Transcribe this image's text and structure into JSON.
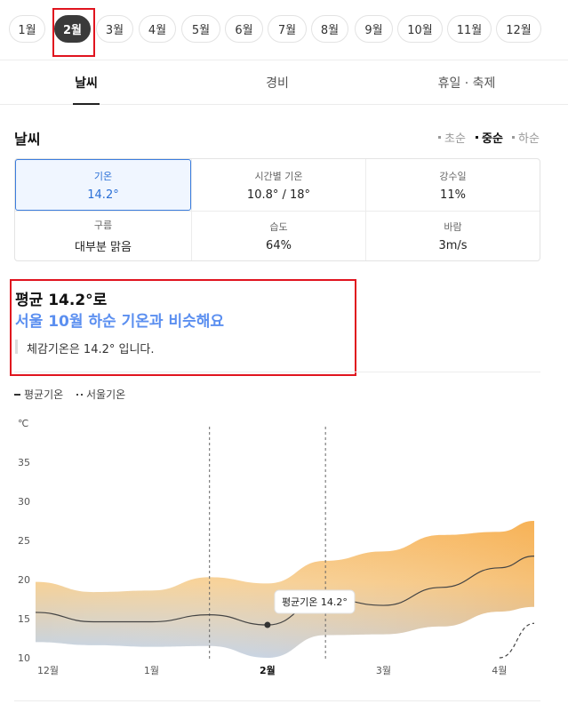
{
  "months": [
    "1월",
    "2월",
    "3월",
    "4월",
    "5월",
    "6월",
    "7월",
    "8월",
    "9월",
    "10월",
    "11월",
    "12월"
  ],
  "active_month": "2월",
  "tabs": [
    "날씨",
    "경비",
    "휴일 · 축제"
  ],
  "section_title": "날씨",
  "seasons": [
    "초순",
    "중순",
    "하순"
  ],
  "active_season": "중순",
  "weather": [
    {
      "label": "기온",
      "value": "14.2°"
    },
    {
      "label": "시간별 기온",
      "value": "10.8° / 18°"
    },
    {
      "label": "강수일",
      "value": "11%"
    },
    {
      "label": "구름",
      "value": "대부분 맑음"
    },
    {
      "label": "습도",
      "value": "64%"
    },
    {
      "label": "바람",
      "value": "3m/s"
    }
  ],
  "summary": {
    "line1": "평균 14.2°로",
    "line2": "서울 10월 하순 기온과 비슷해요",
    "feels": "체감기온은 14.2° 입니다."
  },
  "legend": {
    "avg": "평균기온",
    "seoul": "서울기온"
  },
  "chart_data": {
    "type": "area",
    "ylabel": "℃",
    "y_ticks": [
      "35",
      "30",
      "25",
      "20",
      "15",
      "10"
    ],
    "ylim": [
      10,
      35
    ],
    "x_ticks": [
      "12월",
      "1월",
      "2월",
      "3월",
      "4월"
    ],
    "highlight_tick": "2월",
    "tooltip": "평균기온 14.2°",
    "x": [
      0.0,
      0.5,
      1.0,
      1.5,
      2.0,
      2.5,
      3.0,
      3.5,
      4.0,
      4.3
    ],
    "series": [
      {
        "name": "평균기온",
        "values": [
          15.8,
          14.6,
          14.6,
          15.5,
          14.2,
          17.6,
          16.7,
          19.0,
          21.5,
          23.0
        ]
      },
      {
        "name": "upper",
        "values": [
          19.7,
          18.4,
          18.6,
          20.3,
          19.5,
          22.4,
          23.6,
          25.7,
          26.1,
          27.5
        ]
      },
      {
        "name": "lower",
        "values": [
          12.0,
          11.6,
          11.4,
          11.5,
          10.0,
          12.9,
          13.0,
          14.0,
          15.9,
          16.5
        ]
      },
      {
        "name": "서울기온",
        "values": [
          null,
          null,
          null,
          null,
          null,
          null,
          null,
          null,
          10.0,
          14.4
        ]
      }
    ],
    "colors": {
      "warm": "#f8b75c",
      "cool": "#bcd1ec",
      "line": "#444444"
    }
  },
  "colors": {
    "accent": "#5b8ff0",
    "active_border": "#3b7ddd",
    "highlight_box": "#e0141e"
  }
}
